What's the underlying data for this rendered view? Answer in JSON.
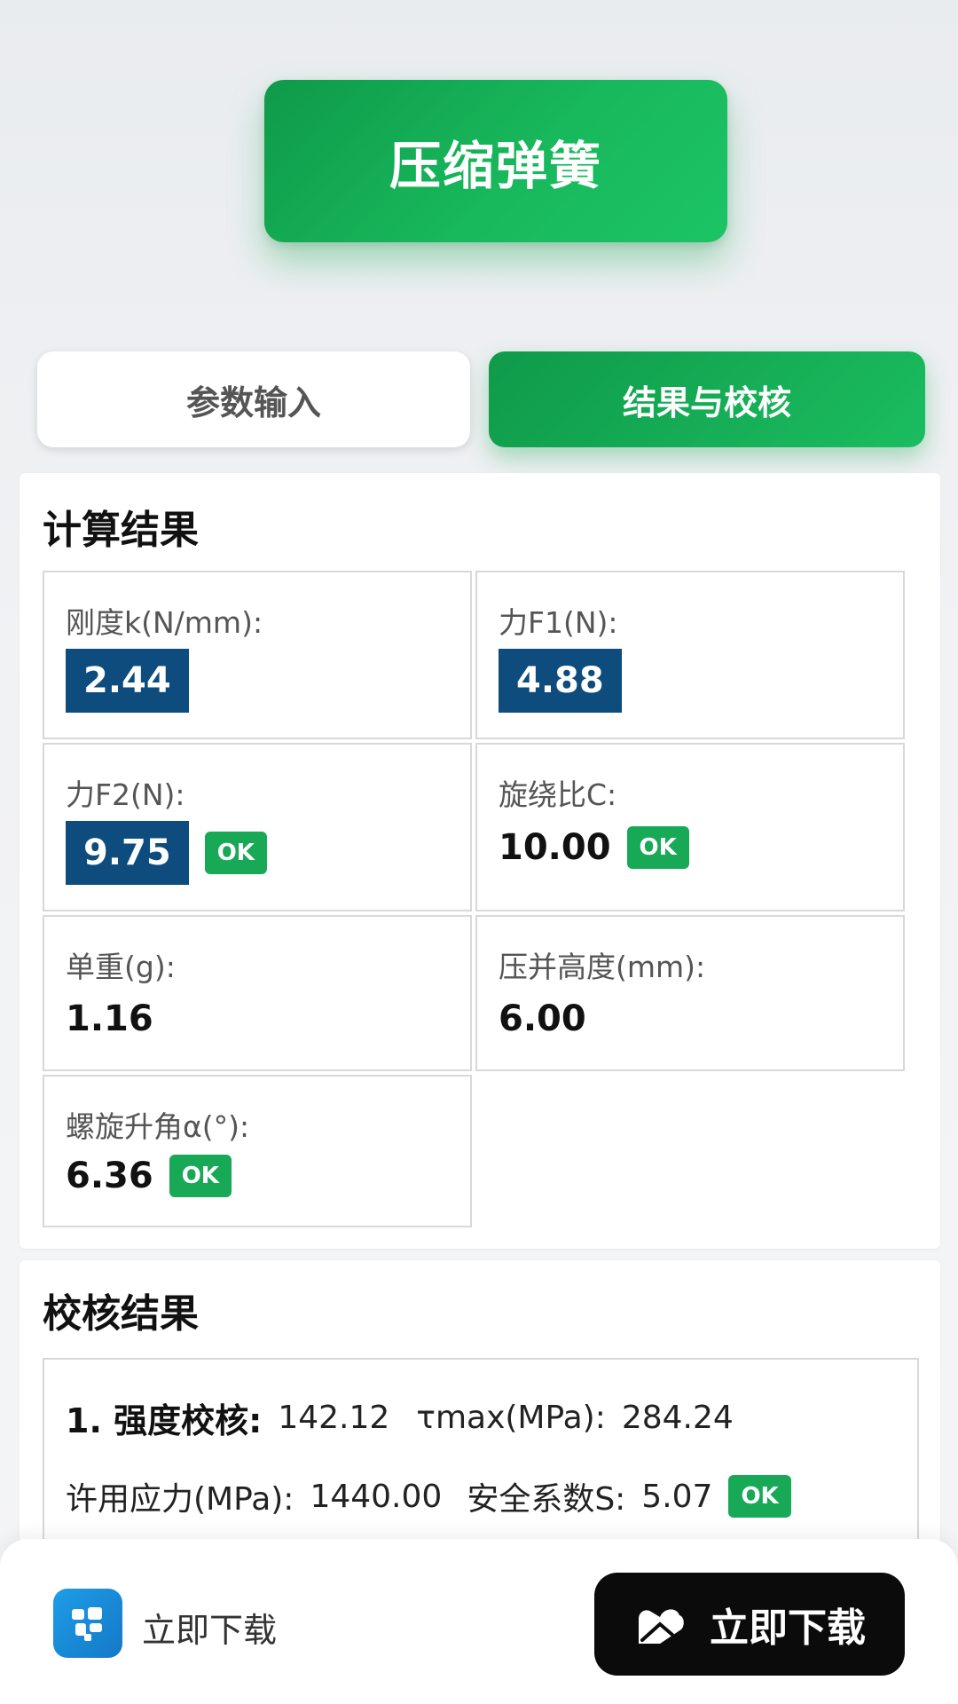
{
  "header": {
    "title": "压缩弹簧"
  },
  "tabs": [
    {
      "label": "参数输入",
      "active": false
    },
    {
      "label": "结果与校核",
      "active": true
    }
  ],
  "calc": {
    "title": "计算结果",
    "items": [
      {
        "label": "刚度k(N/mm):",
        "value": "2.44",
        "ok": ""
      },
      {
        "label": "力F1(N):",
        "value": "4.88",
        "ok": ""
      },
      {
        "label": "力F2(N):",
        "value": "9.75",
        "ok": "OK"
      },
      {
        "label": "旋绕比C:",
        "value": "10.00",
        "ok": "OK"
      },
      {
        "label": "单重(g):",
        "value": "1.16",
        "ok": ""
      },
      {
        "label": "压并高度(mm):",
        "value": "6.00",
        "ok": ""
      },
      {
        "label": "螺旋升角α(°):",
        "value": "6.36",
        "ok": "OK"
      }
    ]
  },
  "check": {
    "title": "校核结果",
    "line1": {
      "title": "1. 强度校核:",
      "value1": "142.12",
      "label2": "τmax(MPa):",
      "value2": "284.24"
    },
    "line2": {
      "label1": "许用应力(MPa):",
      "value1": "1440.00",
      "label2": "安全系数S:",
      "value2": "5.07",
      "ok": "OK"
    }
  },
  "footer": {
    "app_name": "立即下载",
    "download_label": "立即下载",
    "app_icon": "app-logo-icon",
    "download_icon": "app-store-icon"
  },
  "colors": {
    "primary_green": "#18b85c",
    "value_box_blue": "#0e4c7e",
    "ok_green": "#18a957"
  }
}
